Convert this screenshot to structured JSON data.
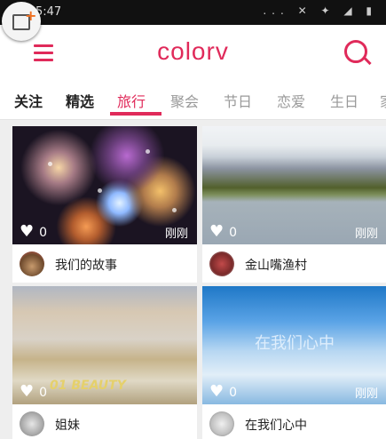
{
  "status_bar": {
    "time": "5:47",
    "icons": "... ✕ ✦ ◢ ▮"
  },
  "header": {
    "logo": "colorv"
  },
  "tabs": [
    "关注",
    "精选",
    "旅行",
    "聚会",
    "节日",
    "恋爱",
    "生日",
    "家"
  ],
  "active_tab": "旅行",
  "accent_color": "#e02a5a",
  "cards": [
    {
      "title": "我们的故事",
      "likes": "0",
      "time": "刚刚",
      "overlay": ""
    },
    {
      "title": "金山嘴渔村",
      "likes": "0",
      "time": "刚刚",
      "overlay": ""
    },
    {
      "title": "姐妹",
      "likes": "0",
      "time": "",
      "overlay": "01 BEAUTY"
    },
    {
      "title": "在我们心中",
      "likes": "0",
      "time": "刚刚",
      "overlay": "在我们心中"
    }
  ]
}
